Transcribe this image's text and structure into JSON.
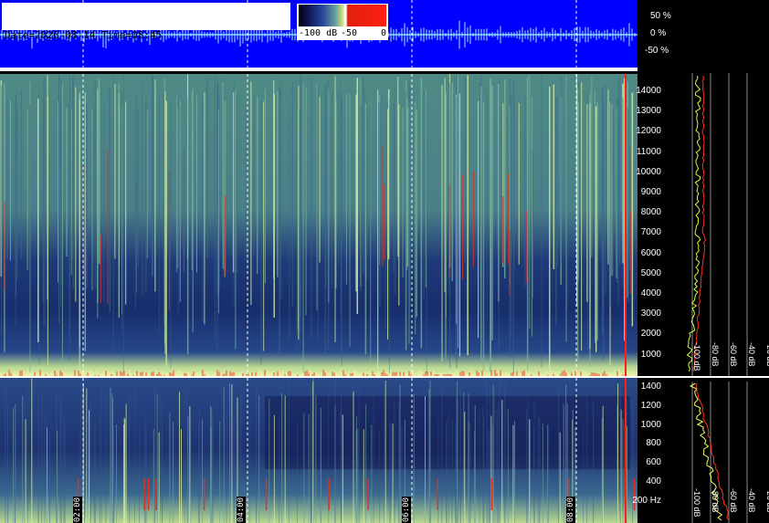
{
  "header": {
    "line1": "Date=2026-08-14 Time=08:45",
    "line2": "Freq= 1...15000 Hz   VLF E-field ©www.vlf.it"
  },
  "colorbar": {
    "labels": [
      "-100 dB",
      "-50",
      "0"
    ]
  },
  "amplitude_axis": [
    "50 %",
    "0 %",
    "-50 %"
  ],
  "freq_axis_top": [
    "14000",
    "13000",
    "12000",
    "11000",
    "10000",
    "9000",
    "8000",
    "7000",
    "6000",
    "5000",
    "4000",
    "3000",
    "2000",
    "1000"
  ],
  "freq_axis_bottom": [
    "1400",
    "1200",
    "1000",
    "800",
    "600",
    "400",
    "200 Hz"
  ],
  "db_axis": [
    "-100 dB",
    "-80 dB",
    "-60 dB",
    "-40 dB",
    "-20 dB"
  ],
  "time_markers": [
    "02:00",
    "04:00",
    "06:00",
    "08:00"
  ],
  "colors": {
    "background": "#000000",
    "wave_bg": "#0000ff",
    "signal": "#00d0ff",
    "marker": "#ff2010"
  }
}
